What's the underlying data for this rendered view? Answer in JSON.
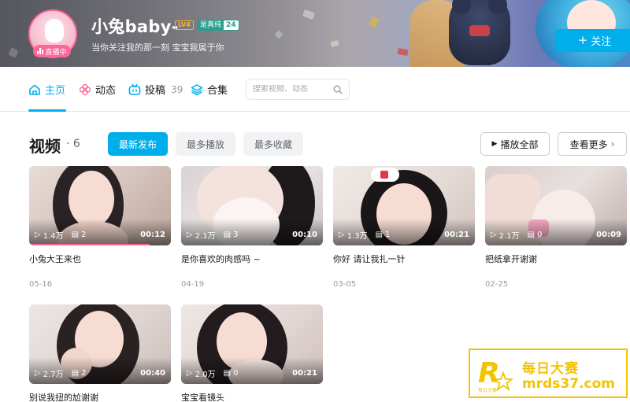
{
  "profile": {
    "name": "小兔baby-",
    "level": "LV4",
    "fan_medal_name": "是真纯",
    "fan_medal_level": "24",
    "signature": "当你关注我的那一刻 宝宝我属于你",
    "live_label": "直播中",
    "follow_label": "关注"
  },
  "nav": {
    "tabs": [
      {
        "label": "主页",
        "count": ""
      },
      {
        "label": "动态",
        "count": ""
      },
      {
        "label": "投稿",
        "count": "39"
      },
      {
        "label": "合集",
        "count": ""
      }
    ],
    "search_placeholder": "搜索视频、动态"
  },
  "section": {
    "title": "视频",
    "count": "· 6",
    "sort_tabs": [
      "最新发布",
      "最多播放",
      "最多收藏"
    ],
    "play_all_label": "播放全部",
    "more_label": "查看更多"
  },
  "videos": [
    {
      "plays": "1.4万",
      "comments": "2",
      "duration": "00:12",
      "title": "小兔大王来也",
      "date": "05-16",
      "watched": 0.85
    },
    {
      "plays": "2.1万",
      "comments": "3",
      "duration": "00:10",
      "title": "是你喜欢的肉感吗 ~",
      "date": "04-19"
    },
    {
      "plays": "1.3万",
      "comments": "1",
      "duration": "00:21",
      "title": "你好 请让我扎一针",
      "date": "03-05"
    },
    {
      "plays": "2.1万",
      "comments": "0",
      "duration": "00:09",
      "title": "把纸拿开谢谢",
      "date": "02-25"
    },
    {
      "plays": "2.7万",
      "comments": "2",
      "duration": "00:40",
      "title": "别说我扭的尬谢谢",
      "date": ""
    },
    {
      "plays": "2.0万",
      "comments": "0",
      "duration": "00:21",
      "title": "宝宝看镜头",
      "date": ""
    }
  ],
  "watermark": {
    "logo_letter": "R",
    "logo_sub": "每日大赛",
    "line1": "每日大赛",
    "line2": "mrds37.com"
  },
  "colors": {
    "accent": "#00aeec",
    "pink": "#ff6699",
    "watermark": "#f2c400"
  }
}
